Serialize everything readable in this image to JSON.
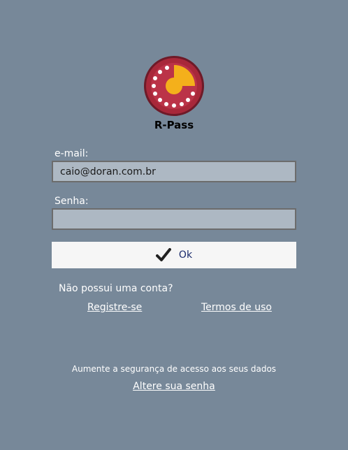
{
  "app": {
    "name": "R-Pass"
  },
  "form": {
    "email_label": "e-mail:",
    "email_value": "caio@doran.com.br",
    "password_label": "Senha:",
    "password_value": "",
    "ok_label": "Ok"
  },
  "signup": {
    "prompt": "Não possui uma conta?",
    "register_link": "Registre-se",
    "terms_link": "Termos de uso"
  },
  "security": {
    "message": "Aumente a segurança de acesso aos seus dados",
    "change_password_link": "Altere sua senha"
  },
  "icons": {
    "logo": "r-pass-logo",
    "ok": "checkmark-icon"
  },
  "colors": {
    "background": "#778899",
    "input_bg": "#adb8c3",
    "button_bg": "#f6f6f6",
    "logo_red": "#a8283a",
    "logo_yellow": "#f4b01b"
  }
}
